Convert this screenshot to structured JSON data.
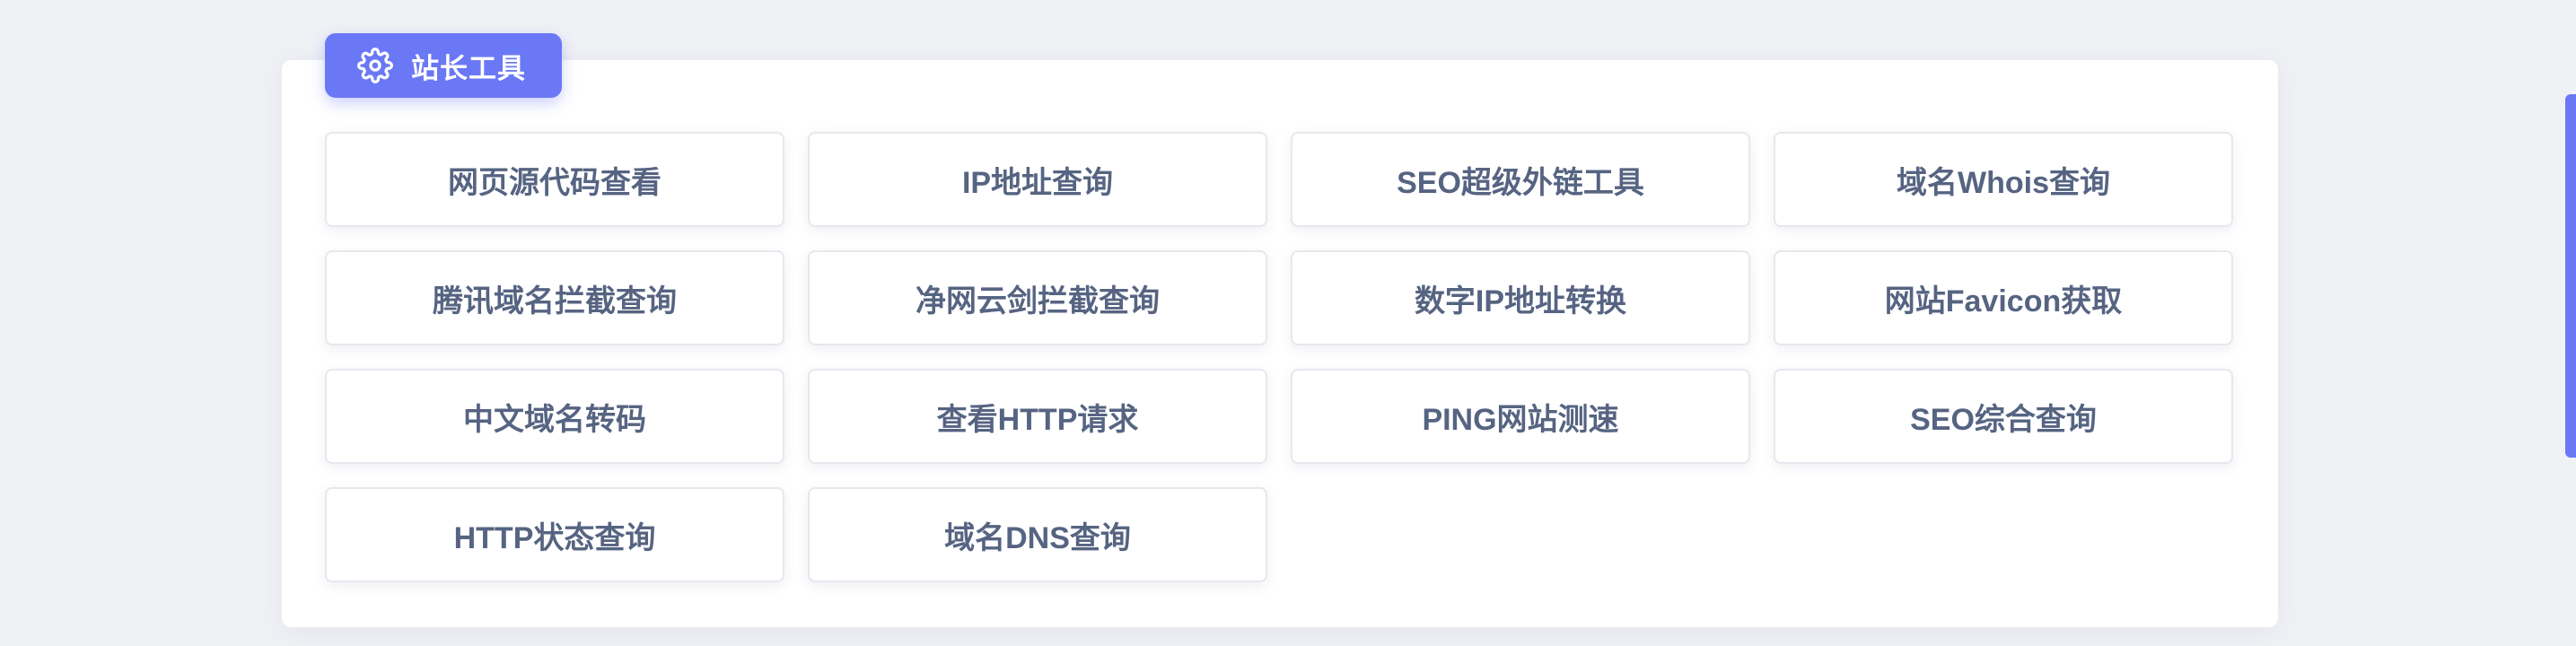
{
  "section": {
    "title": "站长工具",
    "icon": "gear-icon",
    "accent_color": "#6b78f5"
  },
  "tools": [
    {
      "label": "网页源代码查看"
    },
    {
      "label": "IP地址查询"
    },
    {
      "label": "SEO超级外链工具"
    },
    {
      "label": "域名Whois查询"
    },
    {
      "label": "腾讯域名拦截查询"
    },
    {
      "label": "净网云剑拦截查询"
    },
    {
      "label": "数字IP地址转换"
    },
    {
      "label": "网站Favicon获取"
    },
    {
      "label": "中文域名转码"
    },
    {
      "label": "查看HTTP请求"
    },
    {
      "label": "PING网站测速"
    },
    {
      "label": "SEO综合查询"
    },
    {
      "label": "HTTP状态查询"
    },
    {
      "label": "域名DNS查询"
    }
  ],
  "colors": {
    "background": "#f0f1f5",
    "panel": "#ffffff",
    "card_text": "#566482",
    "card_border": "#e6e8ee"
  }
}
